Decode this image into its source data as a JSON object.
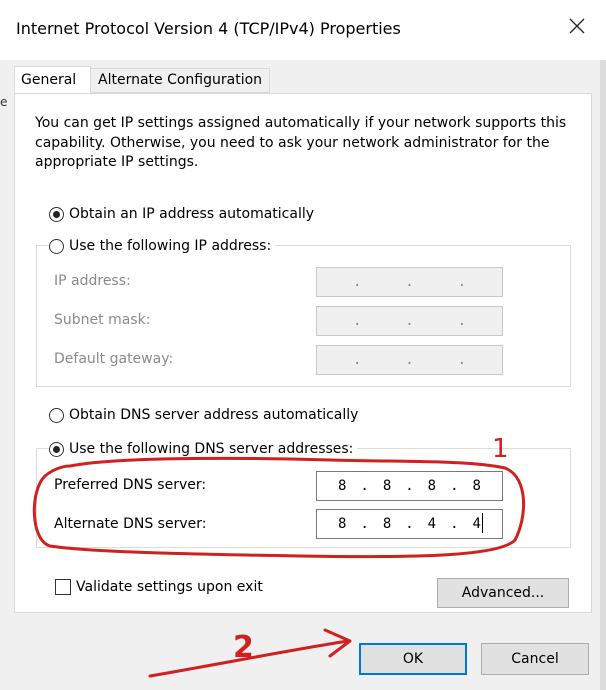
{
  "window": {
    "title": "Internet Protocol Version 4 (TCP/IPv4) Properties",
    "close_icon": "close-icon",
    "left_fragment": "e"
  },
  "tabs": [
    {
      "label": "General",
      "selected": true
    },
    {
      "label": "Alternate Configuration",
      "selected": false
    }
  ],
  "general": {
    "description": "You can get IP settings assigned automatically if your network supports this capability. Otherwise, you need to ask your network administrator for the appropriate IP settings.",
    "ip_mode": {
      "auto_label": "Obtain an IP address automatically",
      "auto_checked": true,
      "manual_label": "Use the following IP address:",
      "manual_checked": false
    },
    "ip_fields": [
      {
        "label": "IP address:",
        "value": ".       .       ."
      },
      {
        "label": "Subnet mask:",
        "value": ".       .       ."
      },
      {
        "label": "Default gateway:",
        "value": ".       .       ."
      }
    ],
    "dns_mode": {
      "auto_label": "Obtain DNS server address automatically",
      "auto_checked": false,
      "manual_label": "Use the following DNS server addresses:",
      "manual_checked": true
    },
    "dns_fields": [
      {
        "label": "Preferred DNS server:",
        "octets": [
          "8",
          "8",
          "8",
          "8"
        ]
      },
      {
        "label": "Alternate DNS server:",
        "octets": [
          "8",
          "8",
          "4",
          "4"
        ]
      }
    ],
    "validate": {
      "label": "Validate settings upon exit",
      "checked": false
    },
    "advanced_label": "Advanced..."
  },
  "footer": {
    "ok_label": "OK",
    "cancel_label": "Cancel"
  },
  "annotations": {
    "label_1": "1",
    "label_2": "2",
    "ink_color": "#d02020"
  }
}
